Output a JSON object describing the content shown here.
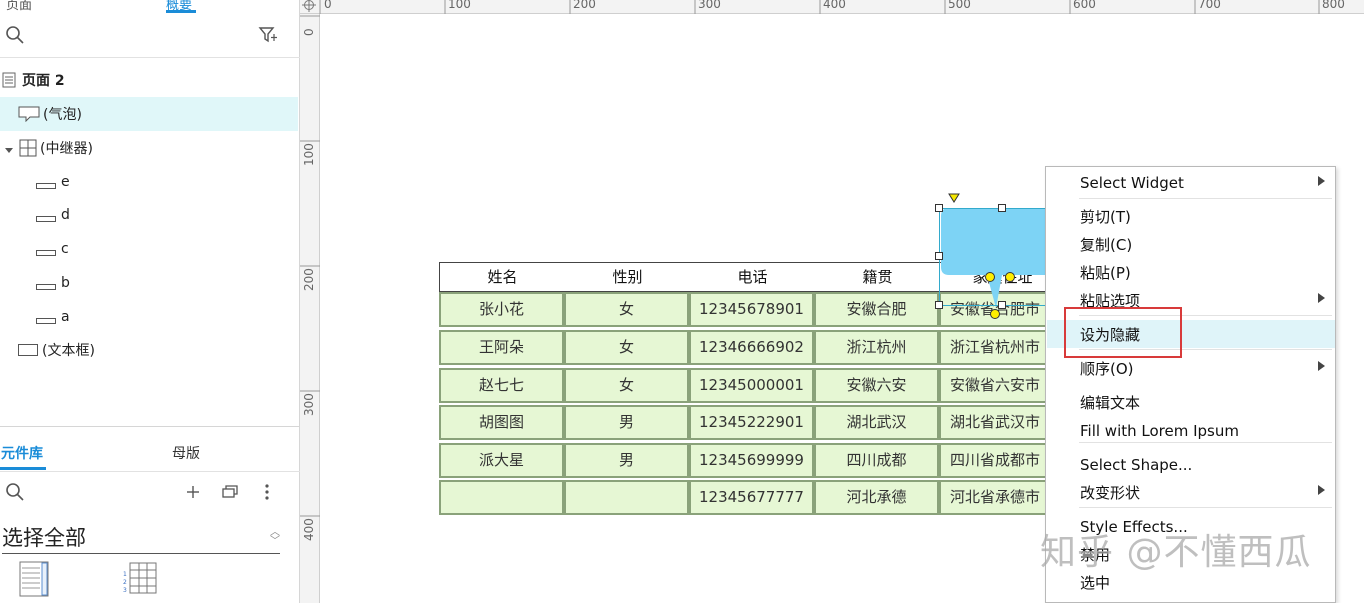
{
  "left_panel": {
    "top_tabs": [
      "页面",
      "概要"
    ],
    "tree": {
      "page": "页面 2",
      "items": [
        "(气泡)",
        "(中继器)",
        "e",
        "d",
        "c",
        "b",
        "a",
        "(文本框)"
      ]
    },
    "library_tabs": {
      "widgets": "元件库",
      "masters": "母版"
    },
    "library_select": "选择全部"
  },
  "rulers": {
    "top": [
      "0",
      "100",
      "200",
      "300",
      "400",
      "500",
      "600",
      "700",
      "800"
    ],
    "left": [
      "0",
      "100",
      "200",
      "300",
      "400"
    ]
  },
  "table": {
    "headers": [
      "姓名",
      "性别",
      "电话",
      "籍贯",
      "家庭住址"
    ],
    "rows": [
      [
        "张小花",
        "女",
        "12345678901",
        "安徽合肥",
        "安徽省合肥市"
      ],
      [
        "王阿朵",
        "女",
        "12346666902",
        "浙江杭州",
        "浙江省杭州市"
      ],
      [
        "赵七七",
        "女",
        "12345000001",
        "安徽六安",
        "安徽省六安市"
      ],
      [
        "胡图图",
        "男",
        "12345222901",
        "湖北武汉",
        "湖北省武汉市"
      ],
      [
        "派大星",
        "男",
        "12345699999",
        "四川成都",
        "四川省成都市"
      ],
      [
        "",
        "",
        "12345677777",
        "河北承德",
        "河北省承德市"
      ]
    ]
  },
  "bubble": {
    "fill": "#7dd3f5"
  },
  "context_menu": {
    "items": [
      {
        "label": "Select Widget",
        "submenu": true
      },
      {
        "label": "剪切(T)"
      },
      {
        "label": "复制(C)"
      },
      {
        "label": "粘贴(P)"
      },
      {
        "label": "粘贴选项",
        "submenu": true
      },
      {
        "label": "设为隐藏",
        "highlighted": true
      },
      {
        "label": "顺序(O)",
        "submenu": true
      },
      {
        "label": "编辑文本"
      },
      {
        "label": "Fill with Lorem Ipsum"
      },
      {
        "label": "Select Shape..."
      },
      {
        "label": "改变形状",
        "submenu": true
      },
      {
        "label": "Style Effects..."
      },
      {
        "label": "禁用"
      },
      {
        "label": "选中"
      }
    ]
  },
  "watermark": "知乎 @不懂西瓜",
  "colors": {
    "accent": "#1a8cd8",
    "cell_fill": "#e6f7d4",
    "cell_border": "#8aa27a",
    "menu_highlight": "#dff4f9",
    "annotation_red": "#d83a3a"
  }
}
